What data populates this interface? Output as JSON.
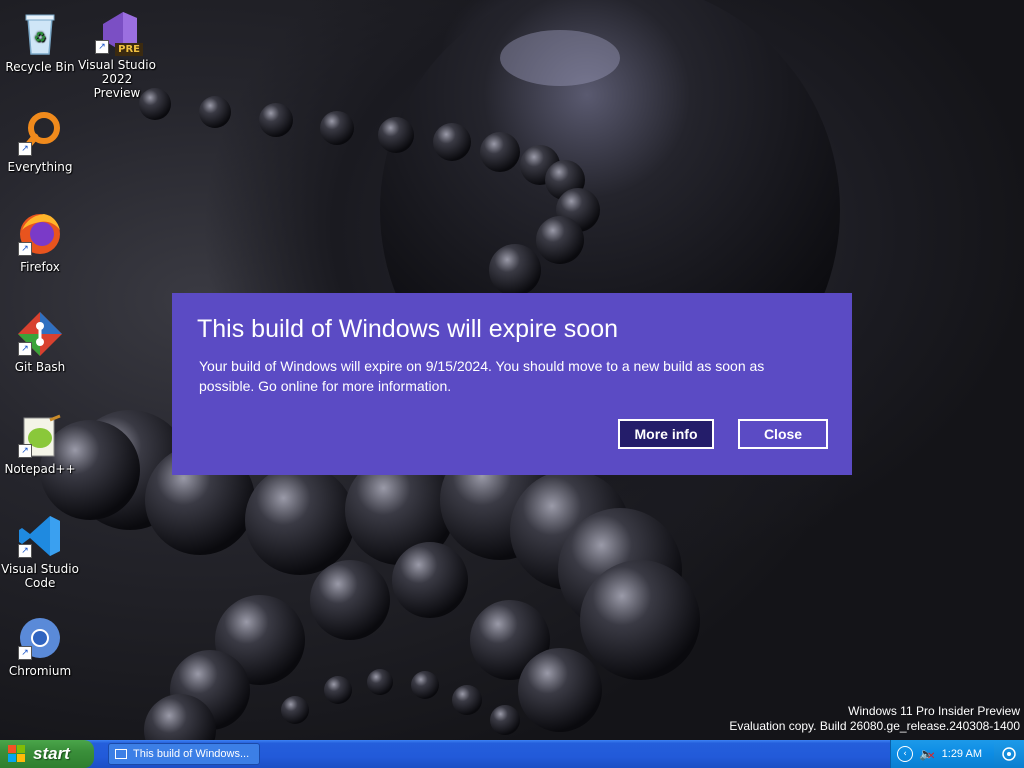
{
  "desktop": {
    "icons": [
      {
        "label": "Recycle Bin",
        "icon": "recycle-bin-icon"
      },
      {
        "label": "Visual Studio 2022 Preview",
        "label_line1": "Visual Studio",
        "label_line2": "2022 Preview",
        "badge": "PRE",
        "icon": "visual-studio-icon"
      },
      {
        "label": "Everything",
        "icon": "everything-search-icon"
      },
      {
        "label": "Firefox",
        "icon": "firefox-icon"
      },
      {
        "label": "Git Bash",
        "icon": "git-bash-icon"
      },
      {
        "label": "Notepad++",
        "icon": "notepad-plus-plus-icon"
      },
      {
        "label": "Visual Studio Code",
        "label_line1": "Visual Studio",
        "label_line2": "Code",
        "icon": "vscode-icon"
      },
      {
        "label": "Chromium",
        "icon": "chromium-icon"
      }
    ]
  },
  "dialog": {
    "title": "This build of Windows will expire soon",
    "body": "Your build of Windows will expire on 9/15/2024. You should move to a new build as soon as possible. Go online for more information.",
    "more_info_label": "More info",
    "close_label": "Close",
    "background_color": "#5b4bc4",
    "primary_button_color": "#241d6a"
  },
  "watermark": {
    "line1": "Windows 11 Pro Insider Preview",
    "line2": "Evaluation copy. Build 26080.ge_release.240308-1400"
  },
  "taskbar": {
    "start_label": "start",
    "task_button_label": "This build of Windows...",
    "tray_time": "1:29 AM",
    "tray_icons": [
      "chevron-left-icon",
      "volume-muted-icon"
    ],
    "show_desktop_icon": "show-desktop-icon"
  }
}
